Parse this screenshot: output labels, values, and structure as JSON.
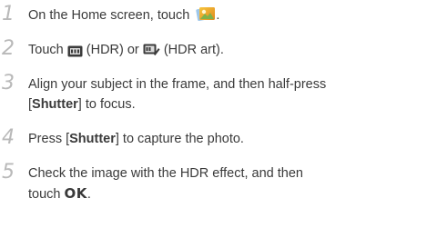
{
  "steps": [
    {
      "num": "1",
      "prefix": "On the Home screen, touch ",
      "suffix": "."
    },
    {
      "num": "2",
      "text_a": "Touch ",
      "text_b": " (HDR) or ",
      "text_c": " (HDR art)."
    },
    {
      "num": "3",
      "line1": "Align your subject in the frame, and then half-press",
      "open": "[",
      "key": "Shutter",
      "close": "] to focus."
    },
    {
      "num": "4",
      "before": "Press [",
      "key": "Shutter",
      "after": "] to capture the photo."
    },
    {
      "num": "5",
      "line1": "Check the image with the HDR effect, and then",
      "line2": "touch ",
      "ok": "OK",
      "end": "."
    }
  ],
  "icons": {
    "step1": "photos-app-icon",
    "step2a": "hdr-mode-icon",
    "step2b": "hdr-art-mode-icon"
  },
  "colors": {
    "number": "#b9b9b9",
    "text": "#3a3a3a"
  }
}
